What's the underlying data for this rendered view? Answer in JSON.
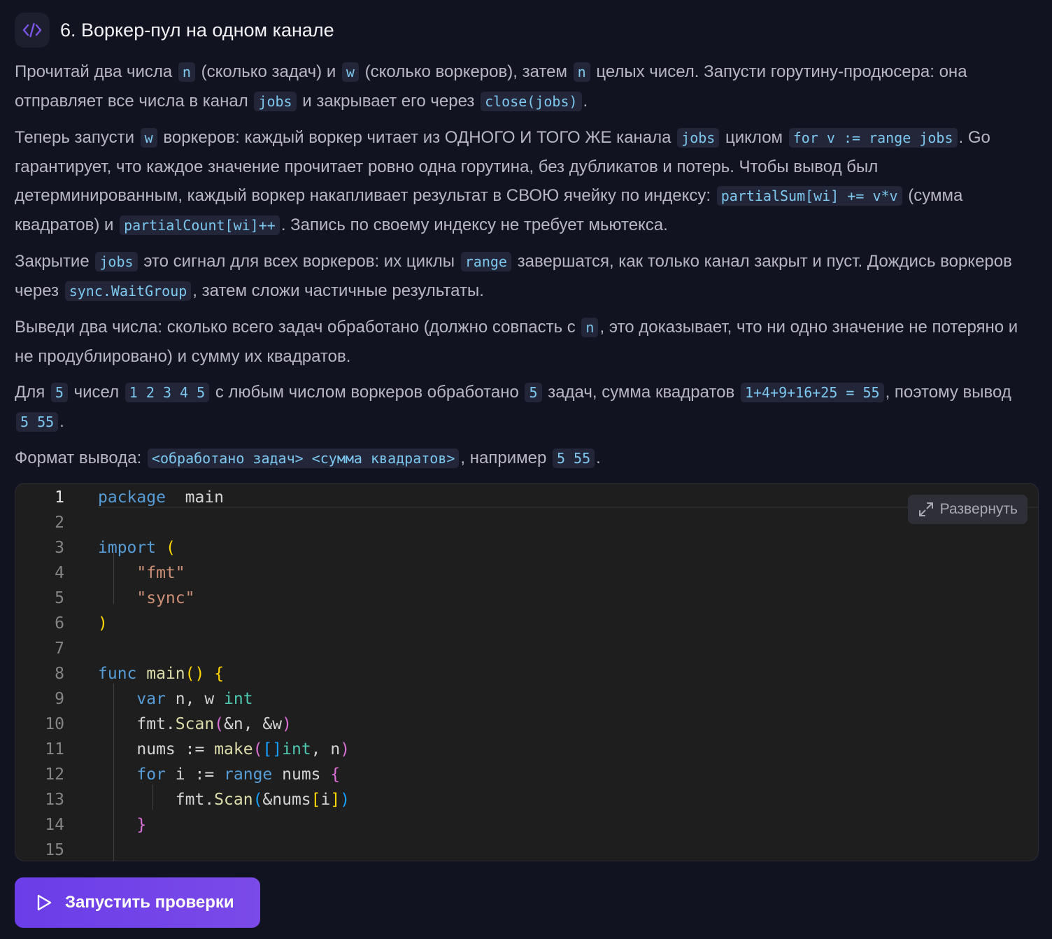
{
  "task": {
    "title": "6. Воркер-пул на одном канале",
    "icon": "code-icon"
  },
  "description": {
    "p1": [
      {
        "t": "Прочитай два числа "
      },
      {
        "c": "n"
      },
      {
        "t": " (сколько задач) и "
      },
      {
        "c": "w"
      },
      {
        "t": " (сколько воркеров), затем "
      },
      {
        "c": "n"
      },
      {
        "t": " целых чисел. Запусти горутину-продюсера: она отправляет все числа в канал "
      },
      {
        "c": "jobs"
      },
      {
        "t": " и закрывает его через "
      },
      {
        "c": "close(jobs)"
      },
      {
        "t": "."
      }
    ],
    "p2": [
      {
        "t": "Теперь запусти "
      },
      {
        "c": "w"
      },
      {
        "t": " воркеров: каждый воркер читает из ОДНОГО И ТОГО ЖЕ канала "
      },
      {
        "c": "jobs"
      },
      {
        "t": " циклом "
      },
      {
        "c": "for v := range jobs"
      },
      {
        "t": ". Go гарантирует, что каждое значение прочитает ровно одна горутина, без дубликатов и потерь. Чтобы вывод был детерминированным, каждый воркер накапливает результат в СВОЮ ячейку по индексу: "
      },
      {
        "c": "partialSum[wi] += v*v"
      },
      {
        "t": " (сумма квадратов) и "
      },
      {
        "c": "partialCount[wi]++"
      },
      {
        "t": ". Запись по своему индексу не требует мьютекса."
      }
    ],
    "p3": [
      {
        "t": "Закрытие "
      },
      {
        "c": "jobs"
      },
      {
        "t": " это сигнал для всех воркеров: их циклы "
      },
      {
        "c": "range"
      },
      {
        "t": " завершатся, как только канал закрыт и пуст. Дождись воркеров через "
      },
      {
        "c": "sync.WaitGroup"
      },
      {
        "t": ", затем сложи частичные результаты."
      }
    ],
    "p4": [
      {
        "t": "Выведи два числа: сколько всего задач обработано (должно совпасть с "
      },
      {
        "c": "n"
      },
      {
        "t": ", это доказывает, что ни одно значение не потеряно и не продублировано) и сумму их квадратов."
      }
    ],
    "p5": [
      {
        "t": "Для "
      },
      {
        "c": "5"
      },
      {
        "t": " чисел "
      },
      {
        "c": "1 2 3 4 5"
      },
      {
        "t": " с любым числом воркеров обработано "
      },
      {
        "c": "5"
      },
      {
        "t": " задач, сумма квадратов "
      },
      {
        "c": "1+4+9+16+25 = 55"
      },
      {
        "t": ", поэтому вывод "
      },
      {
        "c": "5 55"
      },
      {
        "t": "."
      }
    ],
    "p6": [
      {
        "t": "Формат вывода: "
      },
      {
        "c": "<обработано задач> <сумма квадратов>"
      },
      {
        "t": ", например "
      },
      {
        "c": "5 55"
      },
      {
        "t": "."
      }
    ]
  },
  "editor": {
    "expand_label": "Развернуть",
    "expand_icon": "expand-icon",
    "active_line": 1,
    "lines": [
      [
        [
          "kw",
          "package"
        ],
        [
          "",
          "  main"
        ]
      ],
      [],
      [
        [
          "kw",
          "import"
        ],
        [
          "",
          ""
        ],
        [
          "b1",
          " ("
        ]
      ],
      [
        [
          "",
          "    "
        ],
        [
          "str",
          "\"fmt\""
        ]
      ],
      [
        [
          "",
          "    "
        ],
        [
          "str",
          "\"sync\""
        ]
      ],
      [
        [
          "b1",
          ")"
        ]
      ],
      [],
      [
        [
          "kw",
          "func"
        ],
        [
          "",
          " "
        ],
        [
          "fn",
          "main"
        ],
        [
          "b1",
          "()"
        ],
        [
          "",
          " "
        ],
        [
          "b1",
          "{"
        ]
      ],
      [
        [
          "",
          "    "
        ],
        [
          "kw",
          "var"
        ],
        [
          "",
          " n, w "
        ],
        [
          "ty",
          "int"
        ]
      ],
      [
        [
          "",
          "    fmt."
        ],
        [
          "fn",
          "Scan"
        ],
        [
          "b2",
          "("
        ],
        [
          "",
          "&n, &w"
        ],
        [
          "b2",
          ")"
        ]
      ],
      [
        [
          "",
          "    nums := "
        ],
        [
          "fn",
          "make"
        ],
        [
          "b2",
          "("
        ],
        [
          "b3",
          "[]"
        ],
        [
          "ty",
          "int"
        ],
        [
          "",
          ", n"
        ],
        [
          "b2",
          ")"
        ]
      ],
      [
        [
          "",
          "    "
        ],
        [
          "kw",
          "for"
        ],
        [
          "",
          " i := "
        ],
        [
          "kw",
          "range"
        ],
        [
          "",
          " nums "
        ],
        [
          "b2",
          "{"
        ]
      ],
      [
        [
          "",
          "        fmt."
        ],
        [
          "fn",
          "Scan"
        ],
        [
          "b3",
          "("
        ],
        [
          "",
          "&nums"
        ],
        [
          "b1",
          "["
        ],
        [
          "",
          "i"
        ],
        [
          "b1",
          "]"
        ],
        [
          "b3",
          ")"
        ]
      ],
      [
        [
          "",
          "    "
        ],
        [
          "b2",
          "}"
        ]
      ],
      []
    ]
  },
  "run_button": {
    "label": "Запустить проверки",
    "icon": "play-icon"
  },
  "colors": {
    "background": "#121320",
    "inline_code": "#7dc8f0",
    "accent": "#6a3de8"
  }
}
